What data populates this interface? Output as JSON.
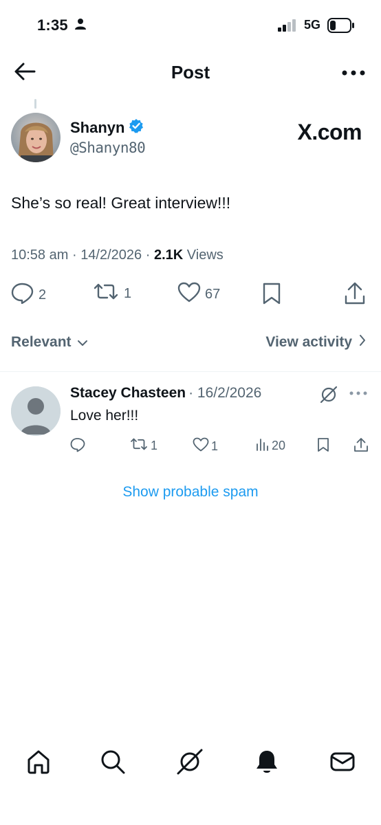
{
  "status_bar": {
    "time": "1:35",
    "network": "5G",
    "icons": [
      "person-icon",
      "signal-icon",
      "battery-icon"
    ]
  },
  "header": {
    "title": "Post",
    "icons": [
      "back-arrow-icon",
      "more-icon"
    ]
  },
  "post": {
    "author_name": "Shanyn",
    "author_handle": "@Shanyn80",
    "verified": true,
    "brand_logo": "X.com",
    "text": "She’s so real! Great interview!!!",
    "time": "10:58 am",
    "separator": "·",
    "date": "14/2/2026",
    "views_count": "2.1K",
    "views_label": "Views",
    "actions": {
      "replies": "2",
      "reposts": "1",
      "likes": "67"
    }
  },
  "filter": {
    "sort_label": "Relevant",
    "view_activity_label": "View activity"
  },
  "reply": {
    "name": "Stacey Chasteen",
    "date": "· 16/2/2026",
    "text": "Love her!!!",
    "actions": {
      "reposts": "1",
      "likes": "1",
      "views": "20"
    }
  },
  "show_spam_label": "Show probable spam",
  "bottom_nav": [
    "home-icon",
    "search-icon",
    "grok-icon",
    "notifications-icon",
    "messages-icon"
  ],
  "colors": {
    "text": "#0f1419",
    "secondary": "#536471",
    "accent": "#1d9bf0",
    "divider": "#eff3f4"
  }
}
